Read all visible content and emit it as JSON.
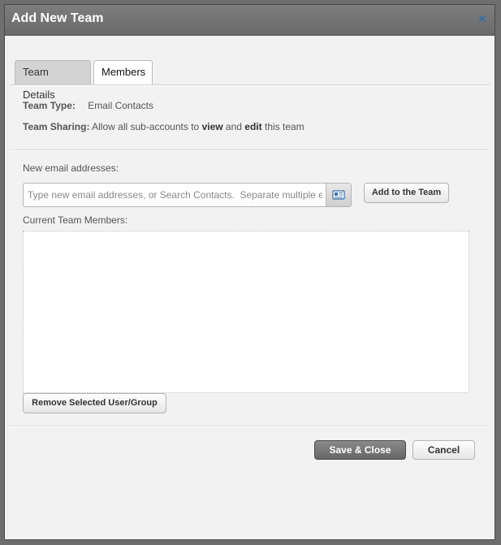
{
  "dialog": {
    "title": "Add New Team",
    "close_label": "×"
  },
  "tabs": [
    {
      "label": "Team Details",
      "active": false
    },
    {
      "label": "Members",
      "active": true
    }
  ],
  "team_info": {
    "type_label": "Team Type:",
    "type_value": "Email Contacts",
    "sharing_label": "Team Sharing:",
    "sharing_text_1": "Allow all sub-accounts to",
    "sharing_view": "view",
    "sharing_and": "and",
    "sharing_edit": "edit",
    "sharing_text_2": "this team"
  },
  "email": {
    "label": "New email addresses:",
    "placeholder": "Type new email addresses, or Search Contacts.  Separate multiple emails with commas",
    "value": "",
    "contacts_icon": "address-card-icon",
    "add_button": "Add to the Team"
  },
  "members": {
    "label": "Current Team Members:",
    "items": [],
    "remove_button": "Remove Selected User/Group"
  },
  "footer": {
    "save_button": "Save & Close",
    "cancel_button": "Cancel"
  },
  "colors": {
    "titlebar": "#737373",
    "close_icon": "#2b6ea8",
    "primary_button": "#777777",
    "contacts_icon": "#3a6ea5"
  }
}
